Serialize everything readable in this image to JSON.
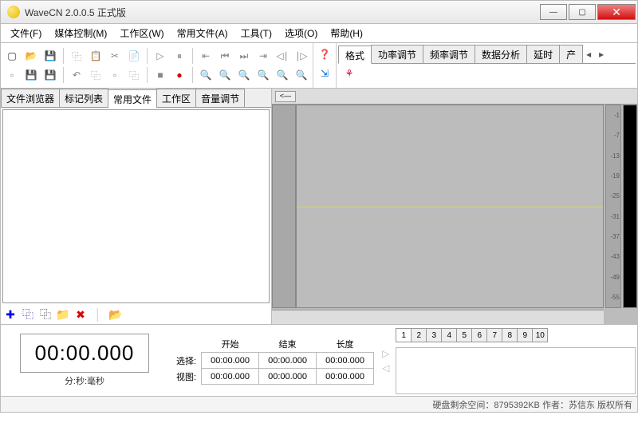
{
  "window": {
    "title": "WaveCN 2.0.0.5 正式版"
  },
  "menu": [
    "文件(F)",
    "媒体控制(M)",
    "工作区(W)",
    "常用文件(A)",
    "工具(T)",
    "选项(O)",
    "帮助(H)"
  ],
  "right_tabs": {
    "items": [
      "格式",
      "功率调节",
      "频率调节",
      "数据分析",
      "延时",
      "产"
    ],
    "active": 0
  },
  "left_tabs": {
    "items": [
      "文件浏览器",
      "标记列表",
      "常用文件",
      "工作区",
      "音量调节"
    ],
    "active": 2
  },
  "scale_db": [
    "-1",
    "-7",
    "-13",
    "-19",
    "-25",
    "-31",
    "-37",
    "-43",
    "-49",
    "-55"
  ],
  "timer": {
    "value": "00:00.000",
    "label": "分:秒:毫秒"
  },
  "timegrid": {
    "headers": [
      "开始",
      "结束",
      "长度"
    ],
    "rows": [
      {
        "label": "选择:",
        "values": [
          "00:00.000",
          "00:00.000",
          "00:00.000"
        ]
      },
      {
        "label": "视图:",
        "values": [
          "00:00.000",
          "00:00.000",
          "00:00.000"
        ]
      }
    ]
  },
  "pages": [
    1,
    2,
    3,
    4,
    5,
    6,
    7,
    8,
    9,
    10
  ],
  "statusbar": "硬盘剩余空间：8795392KB   作者：苏信东  版权所有",
  "scrubber": "<—"
}
